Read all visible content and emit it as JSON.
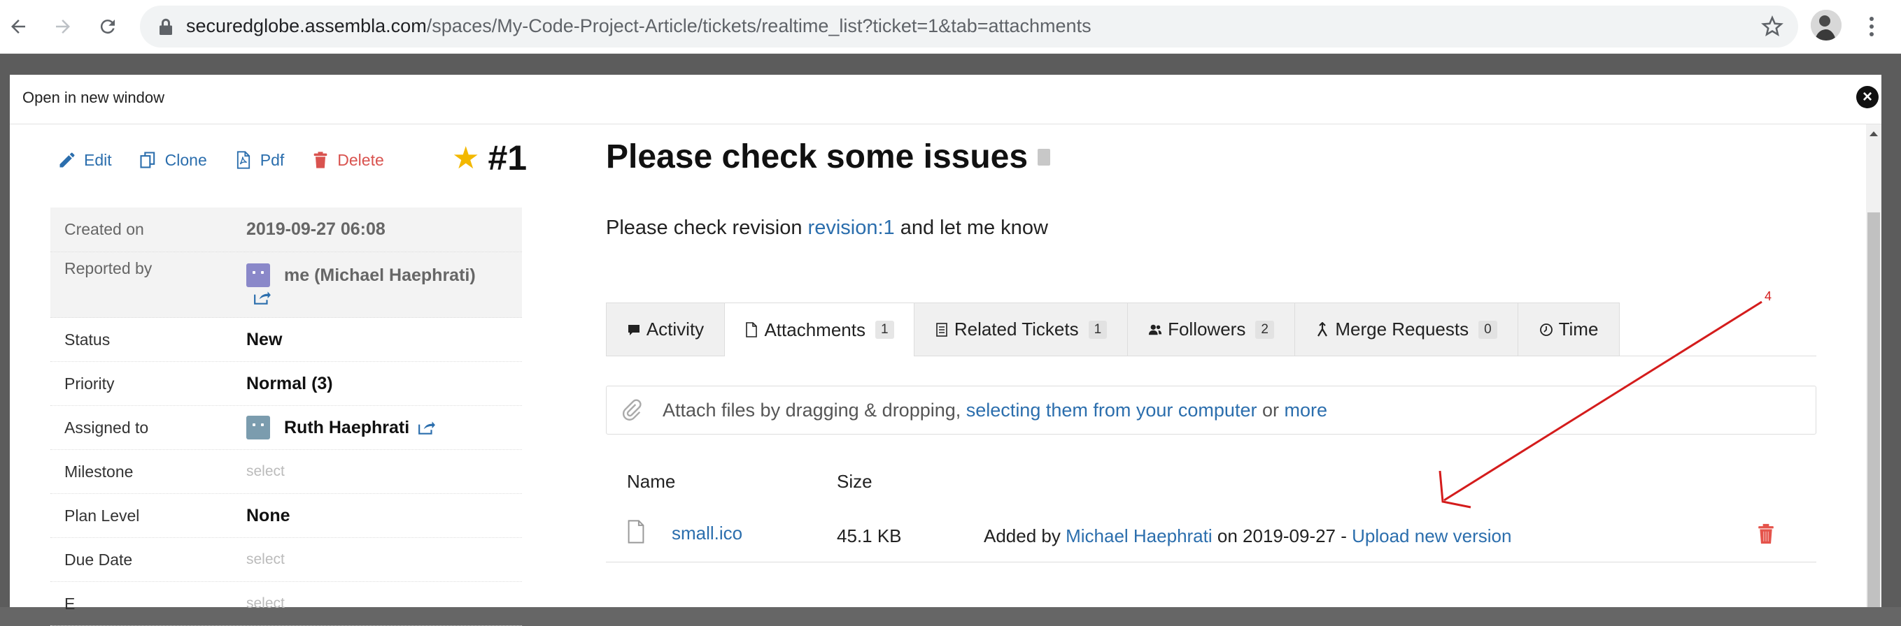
{
  "browser": {
    "url_host": "securedglobe.assembla.com",
    "url_path": "/spaces/My-Code-Project-Article/tickets/realtime_list?ticket=1&tab=attachments"
  },
  "modal": {
    "open_new_window": "Open in new window",
    "close_symbol": "×"
  },
  "toolbar": {
    "edit": "Edit",
    "clone": "Clone",
    "pdf": "Pdf",
    "delete": "Delete"
  },
  "ticket": {
    "number": "#1",
    "title": "Please check some issues",
    "description_prefix": "Please check revision ",
    "description_link": "revision:1",
    "description_suffix": " and let me know"
  },
  "properties": [
    {
      "label": "Created on",
      "value": "2019-09-27 06:08"
    },
    {
      "label": "Reported by",
      "value": "me (Michael Haephrati)"
    },
    {
      "label": "Status",
      "value": "New"
    },
    {
      "label": "Priority",
      "value": "Normal (3)"
    },
    {
      "label": "Assigned to",
      "value": "Ruth Haephrati"
    },
    {
      "label": "Milestone",
      "value": "select"
    },
    {
      "label": "Plan Level",
      "value": "None"
    },
    {
      "label": "Due Date",
      "value": "select"
    },
    {
      "label": "E",
      "value": "select"
    }
  ],
  "tabs": [
    {
      "label": "Activity",
      "count": ""
    },
    {
      "label": "Attachments",
      "count": "1"
    },
    {
      "label": "Related Tickets",
      "count": "1"
    },
    {
      "label": "Followers",
      "count": "2"
    },
    {
      "label": "Merge Requests",
      "count": "0"
    },
    {
      "label": "Time",
      "count": ""
    }
  ],
  "dropzone": {
    "text": "Attach files by dragging & dropping, ",
    "link1": "selecting them from your computer",
    "middle": " or ",
    "link2": "more"
  },
  "attachments": {
    "col_name": "Name",
    "col_size": "Size",
    "rows": [
      {
        "name": "small.ico",
        "size": "45.1 KB",
        "added_by_prefix": "Added by ",
        "user": "Michael Haephrati",
        "date_text": " on 2019-09-27 - ",
        "upload_link": "Upload new version"
      }
    ]
  },
  "annotation": {
    "label": "4",
    "color": "#d41c1c"
  },
  "colors": {
    "link": "#2b6ead",
    "delete": "#d9534f",
    "star": "#f3b800"
  }
}
